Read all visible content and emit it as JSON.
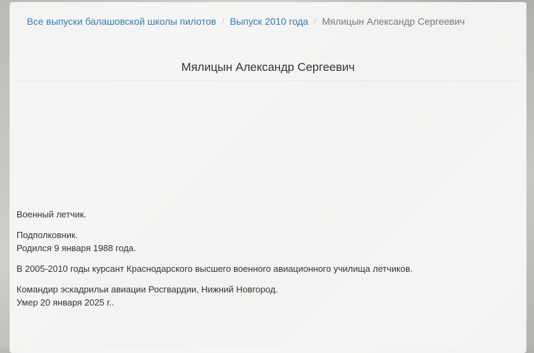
{
  "breadcrumb": {
    "items": [
      "Все выпуски балашовской школы пилотов",
      "Выпуск 2010 года"
    ],
    "current": "Мялицын Александр Сергеевич",
    "separator": "/"
  },
  "title": "Мялицын Александр Сергеевич",
  "bio": {
    "p1": "Военный летчик.",
    "p2a": "Подполковник.",
    "p2b": "Родился 9 января 1988 года.",
    "p3": "В 2005-2010 годы курсант Краснодарского высшего военного авиационного училища летчиков.",
    "p4a": "Командир эскадрильи авиации Росгвардии, Нижний Новгород.",
    "p4b": "Умер 20 января 2025 г.."
  }
}
